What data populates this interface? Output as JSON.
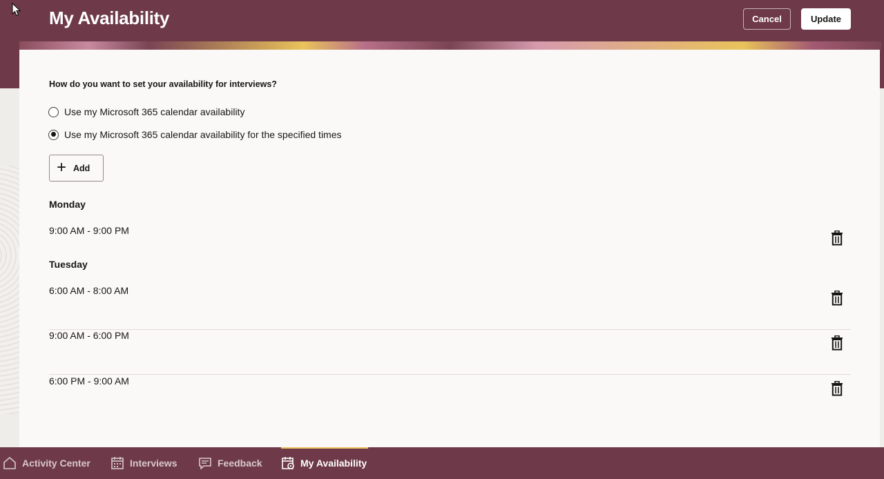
{
  "header": {
    "title": "My Availability",
    "cancel_label": "Cancel",
    "update_label": "Update"
  },
  "form": {
    "question": "How do you want to set your availability for interviews?",
    "options": [
      {
        "label": "Use my Microsoft 365 calendar availability",
        "selected": false
      },
      {
        "label": "Use my Microsoft 365 calendar availability for the specified times",
        "selected": true
      }
    ],
    "add_label": "Add"
  },
  "schedule": [
    {
      "day": "Monday",
      "slots": [
        "9:00 AM - 9:00 PM"
      ]
    },
    {
      "day": "Tuesday",
      "slots": [
        "6:00 AM - 8:00 AM",
        "9:00 AM - 6:00 PM",
        "6:00 PM - 9:00 AM"
      ]
    }
  ],
  "nav": {
    "items": [
      {
        "label": "Activity Center",
        "icon": "home-icon",
        "active": false
      },
      {
        "label": "Interviews",
        "icon": "calendar-icon",
        "active": false
      },
      {
        "label": "Feedback",
        "icon": "feedback-icon",
        "active": false
      },
      {
        "label": "My Availability",
        "icon": "calendar-settings-icon",
        "active": true
      }
    ]
  },
  "colors": {
    "brand": "#6e3a4a",
    "accent": "#e9c35a",
    "card": "#fbf9f8"
  }
}
